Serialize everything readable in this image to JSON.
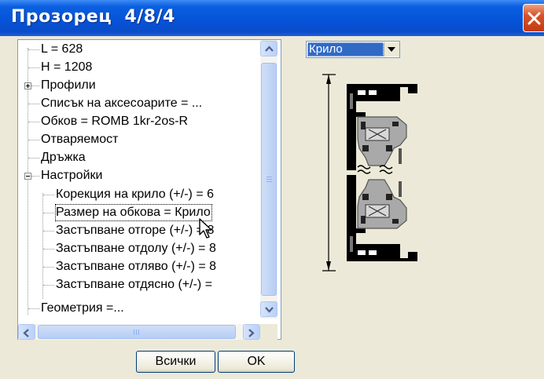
{
  "window": {
    "title": "Прозорец  4/8/4"
  },
  "tree": {
    "items": [
      {
        "label": "L = 628"
      },
      {
        "label": "H = 1208"
      },
      {
        "label": "Профили"
      },
      {
        "label": "Списък на аксесоарите = ..."
      },
      {
        "label": "Обков =   ROMB 1kr-2os-R"
      },
      {
        "label": "Отваряемост"
      },
      {
        "label": "Дръжка"
      },
      {
        "label": "Настройки"
      },
      {
        "label": "Корекция на крило (+/-)   = 6"
      },
      {
        "label": "Размер на обкова   = Крило"
      },
      {
        "label": "Застъпване отгоре (+/-)   = 8"
      },
      {
        "label": "Застъпване отдолу (+/-)   = 8"
      },
      {
        "label": "Застъпване отляво (+/-)   = 8"
      },
      {
        "label": "Застъпване отдясно (+/-)   ="
      },
      {
        "label": "Геометрия  =..."
      }
    ],
    "selected_item": "Размер на обкова   = Крило"
  },
  "buttons": {
    "all_label": "Всички",
    "ok_label": "OK"
  },
  "combo": {
    "value": "Крило"
  },
  "icons": {
    "close": "close-icon",
    "scroll_up": "arrow-up-icon",
    "scroll_down": "arrow-down-icon",
    "scroll_left": "arrow-left-icon",
    "scroll_right": "arrow-right-icon",
    "dropdown": "chevron-down-icon",
    "cursor": "mouse-cursor-icon",
    "preview": "sash-profile-drawing"
  },
  "colors": {
    "titlebar": "#0652d8",
    "window_bg": "#ece9d8",
    "selection": "#316ac5",
    "close_button": "#d8522a",
    "scrollbar": "#b9d0f8"
  }
}
